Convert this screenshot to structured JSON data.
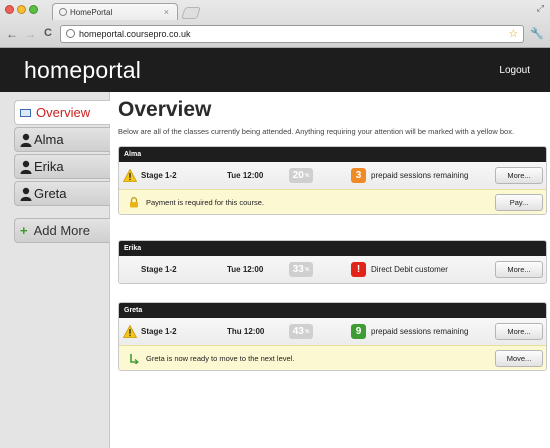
{
  "browser": {
    "tab_title": "HomePortal",
    "tab_close": "×",
    "url": "homeportal.coursepro.co.uk",
    "back_glyph": "←",
    "forward_glyph": "→",
    "reload_glyph": "C",
    "star_glyph": "☆",
    "wrench_glyph": "🔧",
    "resize_glyph": "⤢"
  },
  "header": {
    "brand": "homeportal",
    "logout": "Logout"
  },
  "sidebar": {
    "items": [
      {
        "label": "Overview",
        "icon": "overview-icon",
        "active": true
      },
      {
        "label": "Alma",
        "icon": "person-icon"
      },
      {
        "label": "Erika",
        "icon": "person-icon"
      },
      {
        "label": "Greta",
        "icon": "person-icon"
      }
    ],
    "add": {
      "label": "Add More",
      "icon": "plus-icon"
    }
  },
  "main": {
    "title": "Overview",
    "intro": "Below are all of the classes currently being attended. Anything requiring your attention will be marked with a yellow box.",
    "cards": [
      {
        "name": "Alma",
        "level": "Stage 1-2",
        "time": "Tue 12:00",
        "count": "20",
        "count_suffix": "%",
        "status_value": "3",
        "status_text": "prepaid sessions remaining",
        "status_color": "#f08a24",
        "status_icon": "number-badge",
        "warning": true,
        "button": "More...",
        "notice": {
          "text": "Payment is required for this course.",
          "button": "Pay...",
          "icon": "lock-icon"
        }
      },
      {
        "name": "Erika",
        "level": "Stage 1-2",
        "time": "Tue 12:00",
        "count": "33",
        "count_suffix": "%",
        "status_value": "!",
        "status_text": "Direct Debit customer",
        "status_color": "#e2231a",
        "status_icon": "alert-badge",
        "warning": false,
        "button": "More..."
      },
      {
        "name": "Greta",
        "level": "Stage 1-2",
        "time": "Thu 12:00",
        "count": "43",
        "count_suffix": "%",
        "status_value": "9",
        "status_text": "prepaid sessions remaining",
        "status_color": "#3f9c35",
        "status_icon": "number-badge",
        "warning": true,
        "button": "More...",
        "notice": {
          "text": "Greta is now ready to move to the next level.",
          "button": "Move...",
          "icon": "level-up-icon"
        }
      }
    ]
  },
  "colors": {
    "header_bg": "#1d1d1d",
    "active_nav": "#cc2222",
    "notice_bg": "#fcf8d2",
    "warning": "#f5c518"
  }
}
